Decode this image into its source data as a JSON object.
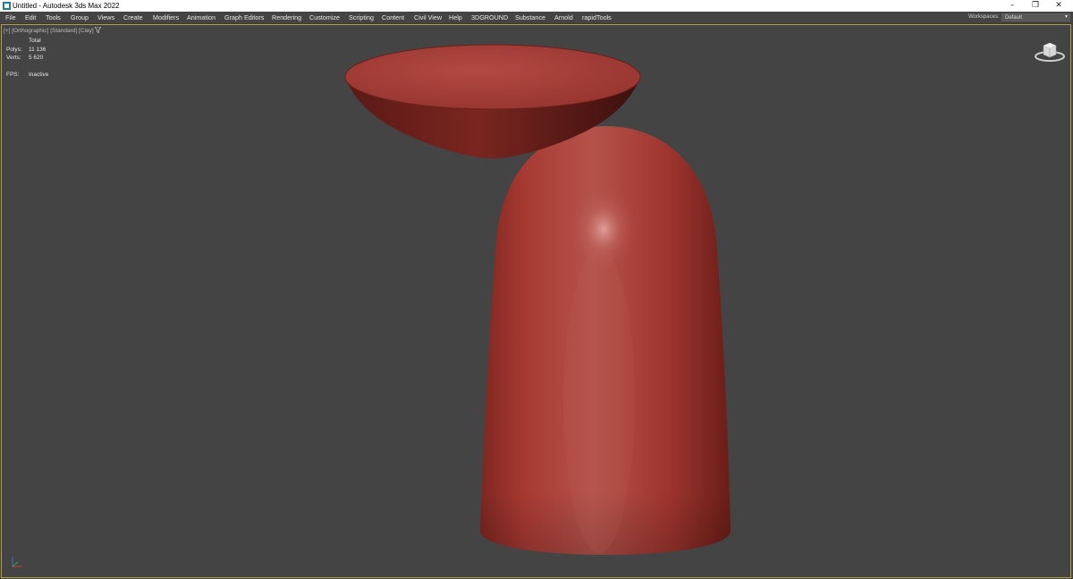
{
  "window": {
    "title": "Untitled - Autodesk 3ds Max 2022",
    "buttons": {
      "minimize": "–",
      "restore": "❐",
      "close": "✕"
    }
  },
  "menu": {
    "items": [
      "File",
      "Edit",
      "Tools",
      "Group",
      "Views",
      "Create",
      "Modifiers",
      "Animation",
      "Graph Editors",
      "Rendering",
      "Customize",
      "Scripting",
      "Content",
      "Civil View",
      "Help",
      "3DGROUND",
      "Substance",
      "Arnold",
      "rapidTools"
    ]
  },
  "workspaces": {
    "label": "Workspaces:",
    "value": "Default"
  },
  "viewport": {
    "label_plus": "[+]",
    "label_view": "[Orthographic]",
    "label_shading": "[Standard]",
    "label_style": "[Clay]",
    "filter_icon": "funnel-icon",
    "stats": {
      "header": "Total",
      "polys_label": "Polys:",
      "polys_value": "11 136",
      "verts_label": "Verts:",
      "verts_value": "5 620",
      "fps_label": "FPS:",
      "fps_value": "Inactive"
    }
  },
  "colors": {
    "viewport_bg": "#444444",
    "clay_red": "#a8403a",
    "active_border": "#b0a040",
    "menu_text": "#e8e8e8"
  }
}
